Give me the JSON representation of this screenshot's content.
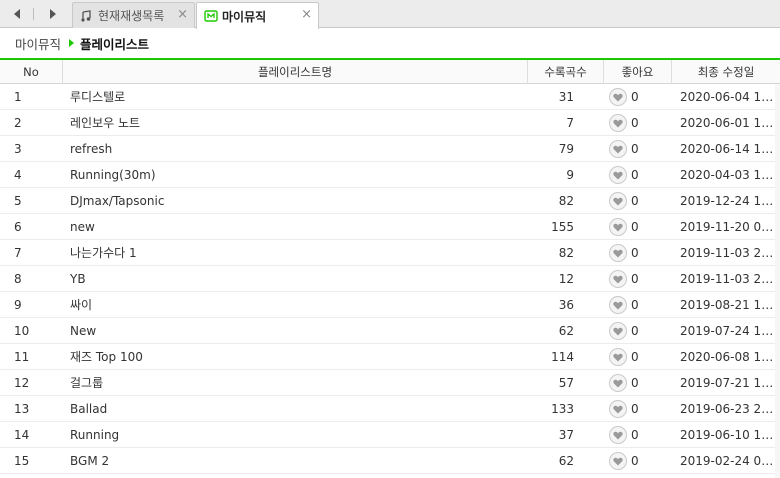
{
  "tabbar": {
    "tabs": [
      {
        "label": "현재재생목록",
        "icon": "music-note-icon",
        "active": false
      },
      {
        "label": "마이뮤직",
        "icon": "mymusic-icon",
        "active": true
      }
    ],
    "close_symbol": "×"
  },
  "breadcrumb": {
    "root": "마이뮤직",
    "current": "플레이리스트"
  },
  "colors": {
    "accent": "#1ec800"
  },
  "table": {
    "columns": [
      "No",
      "플레이리스트명",
      "수록곡수",
      "좋아요",
      "최종 수정일"
    ],
    "rows": [
      {
        "no": "1",
        "name": "루디스텔로",
        "count": "31",
        "likes": "0",
        "date": "2020-06-04 15:..."
      },
      {
        "no": "2",
        "name": "레인보우 노트",
        "count": "7",
        "likes": "0",
        "date": "2020-06-01 15:..."
      },
      {
        "no": "3",
        "name": "refresh",
        "count": "79",
        "likes": "0",
        "date": "2020-06-14 19:..."
      },
      {
        "no": "4",
        "name": "Running(30m)",
        "count": "9",
        "likes": "0",
        "date": "2020-04-03 18:..."
      },
      {
        "no": "5",
        "name": "DJmax/Tapsonic",
        "count": "82",
        "likes": "0",
        "date": "2019-12-24 15:..."
      },
      {
        "no": "6",
        "name": "new",
        "count": "155",
        "likes": "0",
        "date": "2019-11-20 03:..."
      },
      {
        "no": "7",
        "name": "나는가수다 1",
        "count": "82",
        "likes": "0",
        "date": "2019-11-03 20:..."
      },
      {
        "no": "8",
        "name": "YB",
        "count": "12",
        "likes": "0",
        "date": "2019-11-03 20:..."
      },
      {
        "no": "9",
        "name": "싸이",
        "count": "36",
        "likes": "0",
        "date": "2019-08-21 19:..."
      },
      {
        "no": "10",
        "name": "New",
        "count": "62",
        "likes": "0",
        "date": "2019-07-24 19:..."
      },
      {
        "no": "11",
        "name": "재즈 Top 100",
        "count": "114",
        "likes": "0",
        "date": "2020-06-08 19:..."
      },
      {
        "no": "12",
        "name": "걸그룹",
        "count": "57",
        "likes": "0",
        "date": "2019-07-21 18:..."
      },
      {
        "no": "13",
        "name": "Ballad",
        "count": "133",
        "likes": "0",
        "date": "2019-06-23 22:..."
      },
      {
        "no": "14",
        "name": "Running",
        "count": "37",
        "likes": "0",
        "date": "2019-06-10 17:..."
      },
      {
        "no": "15",
        "name": "BGM 2",
        "count": "62",
        "likes": "0",
        "date": "2019-02-24 09:..."
      }
    ]
  }
}
